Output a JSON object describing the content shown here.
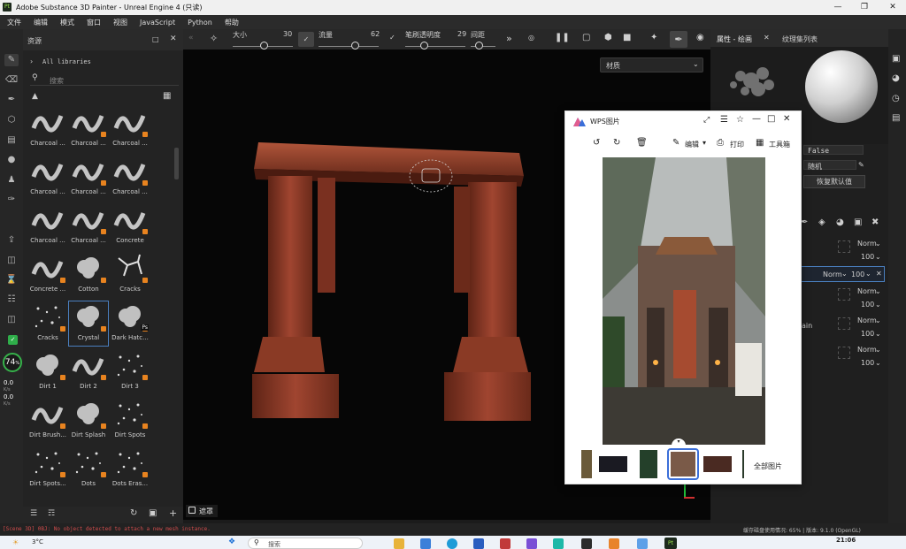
{
  "window": {
    "title": "Adobe Substance 3D Painter - Unreal Engine 4 (只读)",
    "logo": "Pt"
  },
  "menu": [
    "文件",
    "编辑",
    "模式",
    "窗口",
    "视图",
    "JavaScript",
    "Python",
    "帮助"
  ],
  "assets": {
    "title": "资源",
    "library": "All libraries",
    "search_placeholder": "搜索",
    "brushes": [
      "Charcoal ...",
      "Charcoal ...",
      "Charcoal ...",
      "Charcoal ...",
      "Charcoal ...",
      "Charcoal ...",
      "Charcoal ...",
      "Charcoal ...",
      "Concrete",
      "Concrete ...",
      "Cotton",
      "Cracks",
      "Cracks",
      "Crystal",
      "Dark Hatc...",
      "Dirt 1",
      "Dirt 2",
      "Dirt 3",
      "Dirt Brush...",
      "Dirt Splash",
      "Dirt Spots",
      "Dirt Spots...",
      "Dots",
      "Dots Eras..."
    ],
    "selected": "Crystal",
    "ps_badge": "Ps"
  },
  "toolbar": {
    "size_label": "大小",
    "size_value": "30",
    "flow_label": "流量",
    "flow_value": "62",
    "opacity_label": "笔刷透明度",
    "opacity_value": "29",
    "spacing_label": "间距"
  },
  "viewport": {
    "material_dropdown": "材质",
    "mask_label": "遮罩"
  },
  "stats": {
    "percent": "74",
    "percent_suffix": "%",
    "up": "0.0",
    "up_unit": "K/s",
    "down": "0.0",
    "down_unit": "K/s"
  },
  "right_panel": {
    "tab1": "属性 - 绘画",
    "tab2": "纹理集列表",
    "false_value": "False",
    "random_label": "随机",
    "reset_button": "恢复默认值",
    "layers": [
      {
        "blend": "Norm",
        "opacity": "100"
      },
      {
        "blend": "Norm",
        "opacity": "100"
      },
      {
        "blend": "Norm",
        "opacity": "100"
      },
      {
        "blend": "Norm",
        "opacity": "100"
      },
      {
        "blend": "Norm",
        "opacity": "100"
      }
    ],
    "partial_text": "ain"
  },
  "wps": {
    "title": "WPS图片",
    "edit": "编辑",
    "print": "打印",
    "toolbox": "工具箱",
    "all_images": "全部图片"
  },
  "status": {
    "error": "[Scene 3D] 0BJ: No object detected to attach a new mesh instance.",
    "cache": "缓存磁盘使用情况: 65% | 版本: 9.1.0 (OpenGL)"
  },
  "taskbar": {
    "weather": "3°C",
    "search": "搜索",
    "time": "21:06"
  },
  "colors": {
    "accent": "#e8831f",
    "selection": "#4a7fbf",
    "wps_blue": "#3b6fd9"
  }
}
